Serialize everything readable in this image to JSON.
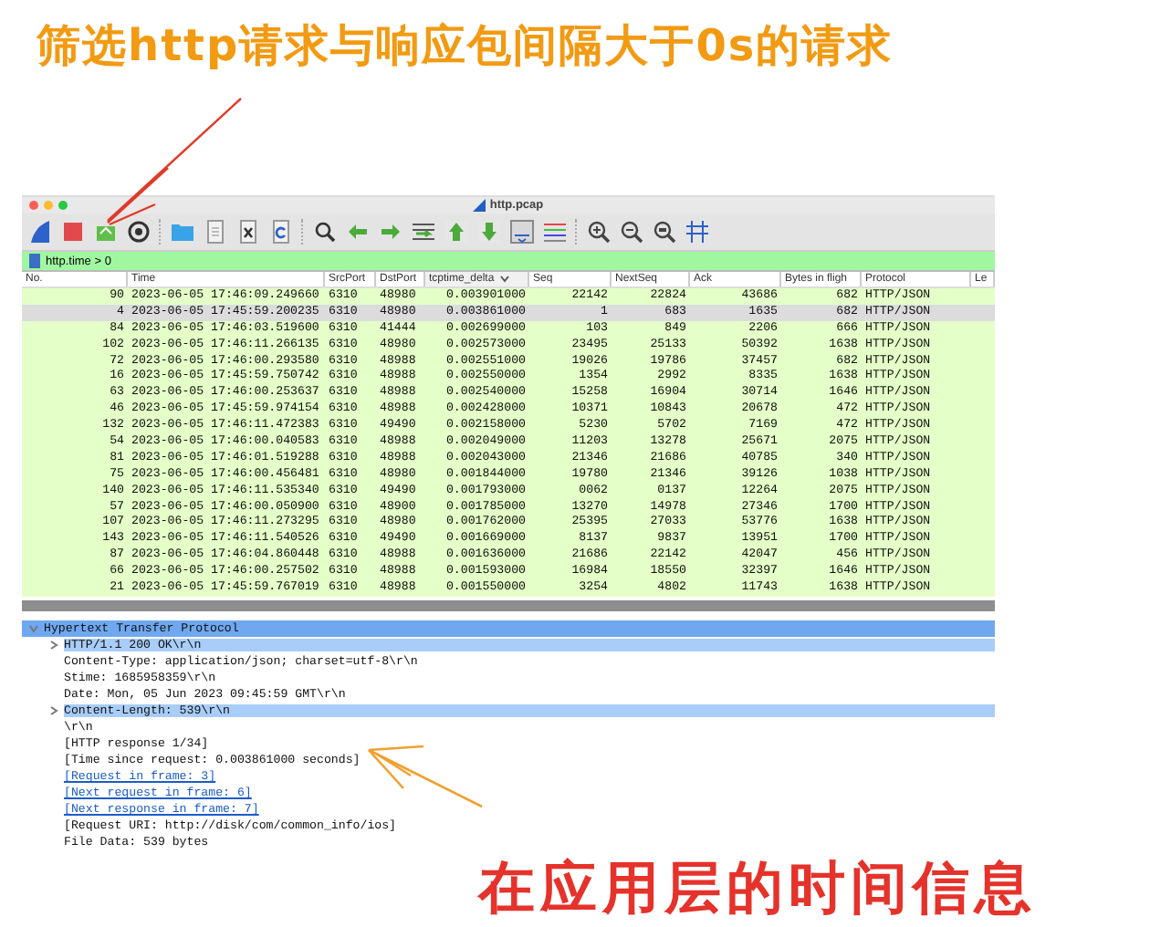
{
  "annotations": {
    "top": "筛选http请求与响应包间隔大于0s的请求",
    "bottom": "在应用层的时间信息"
  },
  "window": {
    "title": "http.pcap"
  },
  "filter": {
    "value": "http.time > 0"
  },
  "table": {
    "columns": [
      {
        "label": "No.",
        "sorted": false
      },
      {
        "label": "Time",
        "sorted": false
      },
      {
        "label": "SrcPort",
        "sorted": false
      },
      {
        "label": "DstPort",
        "sorted": false
      },
      {
        "label": "tcptime_delta",
        "sorted": true
      },
      {
        "label": "Seq",
        "sorted": false
      },
      {
        "label": "NextSeq",
        "sorted": false
      },
      {
        "label": "Ack",
        "sorted": false
      },
      {
        "label": "Bytes in fligh",
        "sorted": false
      },
      {
        "label": "Protocol",
        "sorted": false
      },
      {
        "label": "Le",
        "sorted": false
      }
    ],
    "rows": [
      {
        "selected": false,
        "cells": [
          "90",
          "2023-06-05 17:46:09.249660",
          "6310",
          "48980",
          "0.003901000",
          "22142",
          "22824",
          "43686",
          "682",
          "HTTP/JSON"
        ]
      },
      {
        "selected": true,
        "cells": [
          "4",
          "2023-06-05 17:45:59.200235",
          "6310",
          "48980",
          "0.003861000",
          "1",
          "683",
          "1635",
          "682",
          "HTTP/JSON"
        ]
      },
      {
        "selected": false,
        "cells": [
          "84",
          "2023-06-05 17:46:03.519600",
          "6310",
          "41444",
          "0.002699000",
          "103",
          "849",
          "2206",
          "666",
          "HTTP/JSON"
        ]
      },
      {
        "selected": false,
        "cells": [
          "102",
          "2023-06-05 17:46:11.266135",
          "6310",
          "48980",
          "0.002573000",
          "23495",
          "25133",
          "50392",
          "1638",
          "HTTP/JSON"
        ]
      },
      {
        "selected": false,
        "cells": [
          "72",
          "2023-06-05 17:46:00.293580",
          "6310",
          "48988",
          "0.002551000",
          "19026",
          "19786",
          "37457",
          "682",
          "HTTP/JSON"
        ]
      },
      {
        "selected": false,
        "cells": [
          "16",
          "2023-06-05 17:45:59.750742",
          "6310",
          "48988",
          "0.002550000",
          "1354",
          "2992",
          "8335",
          "1638",
          "HTTP/JSON"
        ]
      },
      {
        "selected": false,
        "cells": [
          "63",
          "2023-06-05 17:46:00.253637",
          "6310",
          "48988",
          "0.002540000",
          "15258",
          "16904",
          "30714",
          "1646",
          "HTTP/JSON"
        ]
      },
      {
        "selected": false,
        "cells": [
          "46",
          "2023-06-05 17:45:59.974154",
          "6310",
          "48988",
          "0.002428000",
          "10371",
          "10843",
          "20678",
          "472",
          "HTTP/JSON"
        ]
      },
      {
        "selected": false,
        "cells": [
          "132",
          "2023-06-05 17:46:11.472383",
          "6310",
          "49490",
          "0.002158000",
          "5230",
          "5702",
          "7169",
          "472",
          "HTTP/JSON"
        ]
      },
      {
        "selected": false,
        "cells": [
          "54",
          "2023-06-05 17:46:00.040583",
          "6310",
          "48988",
          "0.002049000",
          "11203",
          "13278",
          "25671",
          "2075",
          "HTTP/JSON"
        ]
      },
      {
        "selected": false,
        "cells": [
          "81",
          "2023-06-05 17:46:01.519288",
          "6310",
          "48988",
          "0.002043000",
          "21346",
          "21686",
          "40785",
          "340",
          "HTTP/JSON"
        ]
      },
      {
        "selected": false,
        "cells": [
          "75",
          "2023-06-05 17:46:00.456481",
          "6310",
          "48980",
          "0.001844000",
          "19780",
          "21346",
          "39126",
          "1038",
          "HTTP/JSON"
        ]
      },
      {
        "selected": false,
        "cells": [
          "140",
          "2023-06-05 17:46:11.535340",
          "6310",
          "49490",
          "0.001793000",
          "0062",
          "0137",
          "12264",
          "2075",
          "HTTP/JSON"
        ]
      },
      {
        "selected": false,
        "cells": [
          "57",
          "2023-06-05 17:46:00.050900",
          "6310",
          "48900",
          "0.001785000",
          "13270",
          "14978",
          "27346",
          "1700",
          "HTTP/JSON"
        ]
      },
      {
        "selected": false,
        "cells": [
          "107",
          "2023-06-05 17:46:11.273295",
          "6310",
          "48980",
          "0.001762000",
          "25395",
          "27033",
          "53776",
          "1638",
          "HTTP/JSON"
        ]
      },
      {
        "selected": false,
        "cells": [
          "143",
          "2023-06-05 17:46:11.540526",
          "6310",
          "49490",
          "0.001669000",
          "8137",
          "9837",
          "13951",
          "1700",
          "HTTP/JSON"
        ]
      },
      {
        "selected": false,
        "cells": [
          "87",
          "2023-06-05 17:46:04.860448",
          "6310",
          "48988",
          "0.001636000",
          "21686",
          "22142",
          "42047",
          "456",
          "HTTP/JSON"
        ]
      },
      {
        "selected": false,
        "cells": [
          "66",
          "2023-06-05 17:46:00.257502",
          "6310",
          "48988",
          "0.001593000",
          "16984",
          "18550",
          "32397",
          "1646",
          "HTTP/JSON"
        ]
      },
      {
        "selected": false,
        "cells": [
          "21",
          "2023-06-05 17:45:59.767019",
          "6310",
          "48988",
          "0.001550000",
          "3254",
          "4802",
          "11743",
          "1638",
          "HTTP/JSON"
        ]
      }
    ]
  },
  "details": [
    {
      "label": "Hypertext Transfer Protocol",
      "expanded": true,
      "selected": true,
      "children": [
        {
          "label": "HTTP/1.1 200 OK\\r\\n",
          "kind": "field",
          "expanded": false,
          "selected": false,
          "related": true
        },
        {
          "label": "Content-Type: application/json; charset=utf-8\\r\\n",
          "kind": "field",
          "selected": false,
          "related": false
        },
        {
          "label": "Stime: 1685958359\\r\\n",
          "kind": "field",
          "selected": false,
          "related": false
        },
        {
          "label": "Date: Mon, 05 Jun 2023 09:45:59 GMT\\r\\n",
          "kind": "field",
          "selected": false,
          "related": false
        },
        {
          "label": "Content-Length: 539\\r\\n",
          "kind": "field",
          "expanded": false,
          "selected": false,
          "related": true
        },
        {
          "label": "\\r\\n",
          "kind": "field",
          "selected": false,
          "related": false
        },
        {
          "label": "[HTTP response 1/34]",
          "kind": "field",
          "selected": false,
          "related": false
        },
        {
          "label": "[Time since request: 0.003861000 seconds]",
          "kind": "field",
          "selected": false,
          "related": false
        },
        {
          "label": "[Request in frame: 3]",
          "kind": "link",
          "selected": false,
          "related": false
        },
        {
          "label": "[Next request in frame: 6]",
          "kind": "link",
          "selected": false,
          "related": false
        },
        {
          "label": "[Next response in frame: 7]",
          "kind": "link",
          "selected": false,
          "related": false
        },
        {
          "label": "[Request URI: http://disk/com/common_info/ios]",
          "kind": "field",
          "selected": false,
          "related": false
        },
        {
          "label": "File Data: 539 bytes",
          "kind": "field",
          "selected": false,
          "related": false
        }
      ]
    }
  ]
}
